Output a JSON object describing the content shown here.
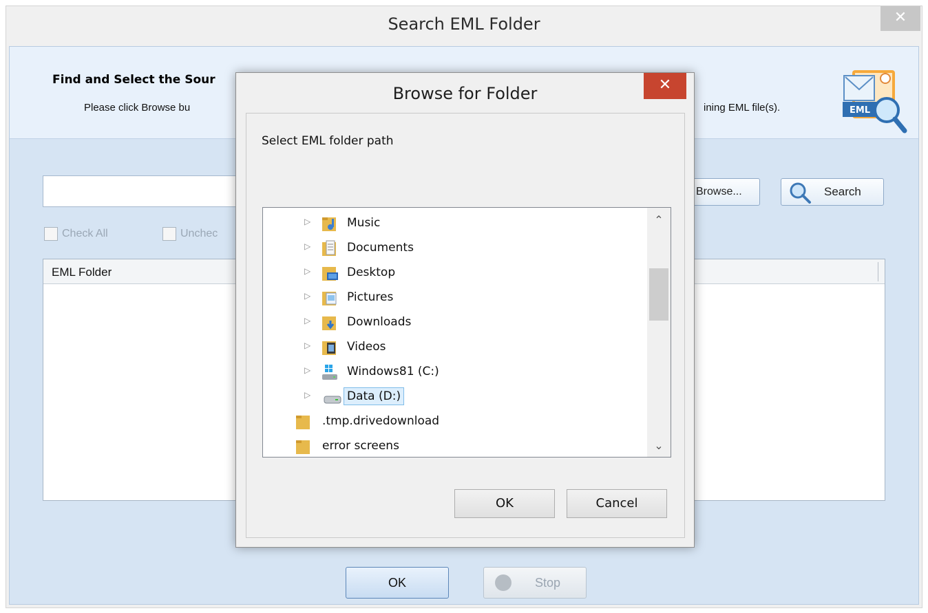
{
  "outer_window": {
    "title": "Search EML Folder",
    "close_glyph": "✕",
    "header_title": "Find and Select the Sour",
    "header_desc_left": "Please click Browse bu",
    "header_desc_right": "ining EML file(s).",
    "logo_text": "EML",
    "path_value": "",
    "browse_label": "Browse...",
    "search_label": "Search",
    "check_all_label": "Check All",
    "uncheck_label": "Unchec",
    "list_column_header": "EML Folder",
    "ok_label": "OK",
    "stop_label": "Stop"
  },
  "dialog": {
    "title": "Browse for Folder",
    "close_glyph": "✕",
    "description": "Select EML folder path",
    "tree_items": [
      {
        "label": "Music",
        "icon": "music-folder-icon",
        "expandable": true,
        "selected": false
      },
      {
        "label": "Documents",
        "icon": "documents-folder-icon",
        "expandable": true,
        "selected": false
      },
      {
        "label": "Desktop",
        "icon": "desktop-folder-icon",
        "expandable": true,
        "selected": false
      },
      {
        "label": "Pictures",
        "icon": "pictures-folder-icon",
        "expandable": true,
        "selected": false
      },
      {
        "label": "Downloads",
        "icon": "downloads-folder-icon",
        "expandable": true,
        "selected": false
      },
      {
        "label": "Videos",
        "icon": "videos-folder-icon",
        "expandable": true,
        "selected": false
      },
      {
        "label": "Windows81 (C:)",
        "icon": "windows-drive-icon",
        "expandable": true,
        "selected": false
      },
      {
        "label": "Data (D:)",
        "icon": "drive-icon",
        "expandable": true,
        "selected": true
      },
      {
        "label": ".tmp.drivedownload",
        "icon": "folder-icon",
        "expandable": false,
        "selected": false
      },
      {
        "label": "error screens",
        "icon": "folder-icon",
        "expandable": false,
        "selected": false
      }
    ],
    "scroll_up_glyph": "⌃",
    "scroll_down_glyph": "⌄",
    "ok_label": "OK",
    "cancel_label": "Cancel"
  },
  "colors": {
    "client_background": "#d6e4f3",
    "header_band": "#e8f1fb",
    "dialog_close_red": "#c7452f",
    "selection_fill": "#dceefc",
    "selection_border": "#7fbce9"
  }
}
